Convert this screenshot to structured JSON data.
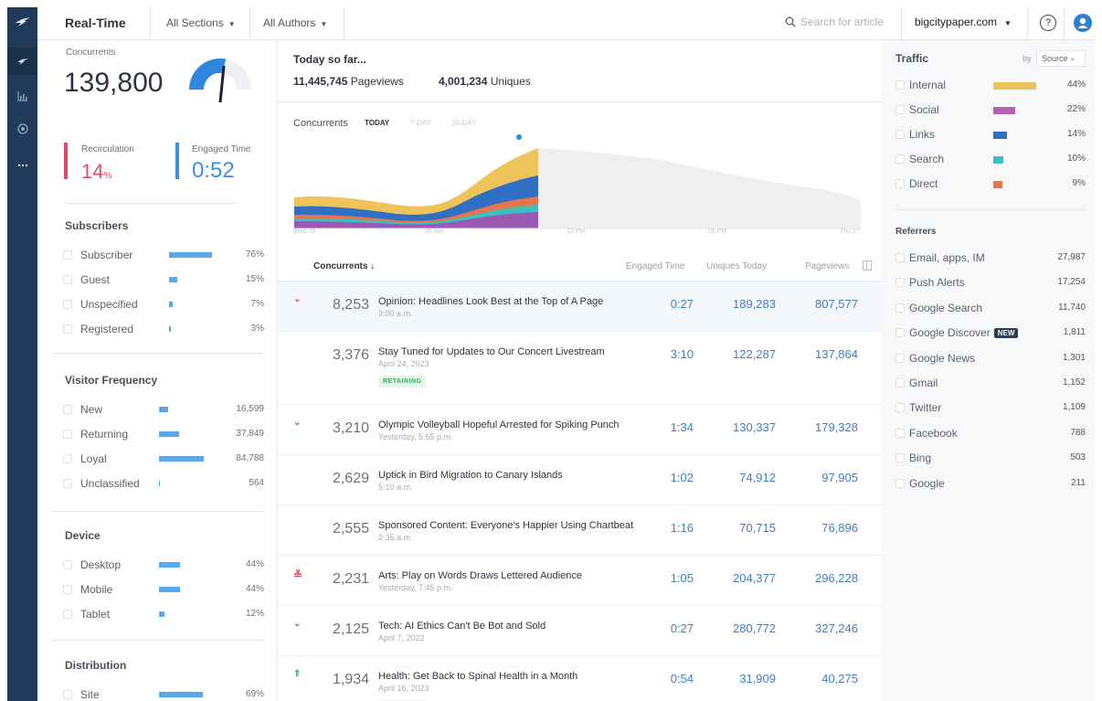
{
  "topbar": {
    "title": "Real-Time",
    "sections": "All Sections",
    "authors": "All Authors",
    "search_placeholder": "Search for article",
    "domain": "bigcitypaper.com",
    "help": "?"
  },
  "left": {
    "concurrents_label": "Concurrents",
    "concurrents_value": "139,800",
    "gauge_level": 0.55,
    "recirc_label": "Recirculation",
    "recirc_value": "14",
    "recirc_unit": "%",
    "engaged_label": "Engaged Time",
    "engaged_value": "0:52",
    "subscribers": {
      "title": "Subscribers",
      "rows": [
        {
          "name": "Subscriber",
          "value": "76%",
          "pct": 76
        },
        {
          "name": "Guest",
          "value": "15%",
          "pct": 15
        },
        {
          "name": "Unspecified",
          "value": "7%",
          "pct": 7
        },
        {
          "name": "Registered",
          "value": "3%",
          "pct": 3
        }
      ]
    },
    "frequency": {
      "title": "Visitor Frequency",
      "rows": [
        {
          "name": "New",
          "value": "16,599",
          "pct": 18
        },
        {
          "name": "Returning",
          "value": "37,849",
          "pct": 40
        },
        {
          "name": "Loyal",
          "value": "84,788",
          "pct": 90
        },
        {
          "name": "Unclassified",
          "value": "564",
          "pct": 1
        }
      ]
    },
    "device": {
      "title": "Device",
      "rows": [
        {
          "name": "Desktop",
          "value": "44%",
          "pct": 44
        },
        {
          "name": "Mobile",
          "value": "44%",
          "pct": 44
        },
        {
          "name": "Tablet",
          "value": "12%",
          "pct": 12
        }
      ]
    },
    "distribution": {
      "title": "Distribution",
      "rows": [
        {
          "name": "Site",
          "value": "69%",
          "pct": 69
        }
      ]
    }
  },
  "summary": {
    "heading": "Today so far...",
    "pageviews_value": "11,445,745",
    "pageviews_label": "Pageviews",
    "uniques_value": "4,001,234",
    "uniques_label": "Uniques"
  },
  "chart_data": {
    "type": "area",
    "title": "Concurrents",
    "tabs": [
      "TODAY",
      "7-DAY",
      "30-DAY"
    ],
    "active_tab": "TODAY",
    "x_ticks": [
      "Wed 26",
      "06 AM",
      "12 PM",
      "06 PM",
      "Thu 27"
    ],
    "series_colors": [
      "#9b59b6",
      "#3dbfbf",
      "#e8744a",
      "#2f6fc4",
      "#eec35a"
    ]
  },
  "table": {
    "headers": {
      "concurrents": "Concurrents",
      "engaged": "Engaged Time",
      "uniques": "Uniques Today",
      "pageviews": "Pageviews"
    },
    "rows": [
      {
        "indicator": "down",
        "conc": "8,253",
        "title": "Opinion: Headlines Look Best at the Top of A Page",
        "date": "3:00 a.m.",
        "engaged": "0:27",
        "uniques": "189,283",
        "pageviews": "807,577"
      },
      {
        "indicator": "",
        "conc": "3,376",
        "title": "Stay Tuned for Updates to Our Concert Livestream",
        "date": "April 24, 2023",
        "badge": "RETAINING",
        "engaged": "3:10",
        "uniques": "122,287",
        "pageviews": "137,864"
      },
      {
        "indicator": "down",
        "conc": "3,210",
        "title": "Olympic Volleyball Hopeful Arrested for Spiking Punch",
        "date": "Yesterday, 5:55 p.m.",
        "engaged": "1:34",
        "uniques": "130,337",
        "pageviews": "179,328"
      },
      {
        "indicator": "",
        "conc": "2,629",
        "title": "Uptick in Bird Migration to Canary Islands",
        "date": "5:10 a.m.",
        "engaged": "1:02",
        "uniques": "74,912",
        "pageviews": "97,905"
      },
      {
        "indicator": "",
        "conc": "2,555",
        "title": "Sponsored Content: Everyone's Happier Using Chartbeat",
        "date": "2:35 a.m.",
        "engaged": "1:16",
        "uniques": "70,715",
        "pageviews": "76,896"
      },
      {
        "indicator": "double-down",
        "conc": "2,231",
        "title": "Arts: Play on Words Draws Lettered Audience",
        "date": "Yesterday, 7:45 p.m.",
        "engaged": "1:05",
        "uniques": "204,377",
        "pageviews": "296,228"
      },
      {
        "indicator": "down",
        "conc": "2,125",
        "title": "Tech: AI Ethics Can't Be Bot and Sold",
        "date": "April 7, 2022",
        "engaged": "0:27",
        "uniques": "280,772",
        "pageviews": "327,246"
      },
      {
        "indicator": "triple-up",
        "conc": "1,934",
        "title": "Health: Get Back to Spinal Health in a Month",
        "date": "April 16, 2023",
        "badge": "ACQUIRING",
        "engaged": "0:54",
        "uniques": "31,909",
        "pageviews": "40,275"
      }
    ]
  },
  "traffic": {
    "title": "Traffic",
    "by_label": "by",
    "by_value": "Source",
    "rows": [
      {
        "name": "Internal",
        "value": "44%",
        "pct": 44,
        "color": "#eec35a"
      },
      {
        "name": "Social",
        "value": "22%",
        "pct": 22,
        "color": "#b462b4"
      },
      {
        "name": "Links",
        "value": "14%",
        "pct": 14,
        "color": "#2f6fc4"
      },
      {
        "name": "Search",
        "value": "10%",
        "pct": 10,
        "color": "#3dbfbf"
      },
      {
        "name": "Direct",
        "value": "9%",
        "pct": 9,
        "color": "#e8744a"
      }
    ]
  },
  "referrers": {
    "title": "Referrers",
    "new_badge": "NEW",
    "rows": [
      {
        "name": "Email, apps, IM",
        "value": "27,987"
      },
      {
        "name": "Push Alerts",
        "value": "17,254"
      },
      {
        "name": "Google Search",
        "value": "11,740"
      },
      {
        "name": "Google Discover",
        "value": "1,811",
        "new": true
      },
      {
        "name": "Google News",
        "value": "1,301"
      },
      {
        "name": "Gmail",
        "value": "1,152"
      },
      {
        "name": "Twitter",
        "value": "1,109"
      },
      {
        "name": "Facebook",
        "value": "788"
      },
      {
        "name": "Bing",
        "value": "503"
      },
      {
        "name": "Google",
        "value": "211"
      }
    ]
  }
}
